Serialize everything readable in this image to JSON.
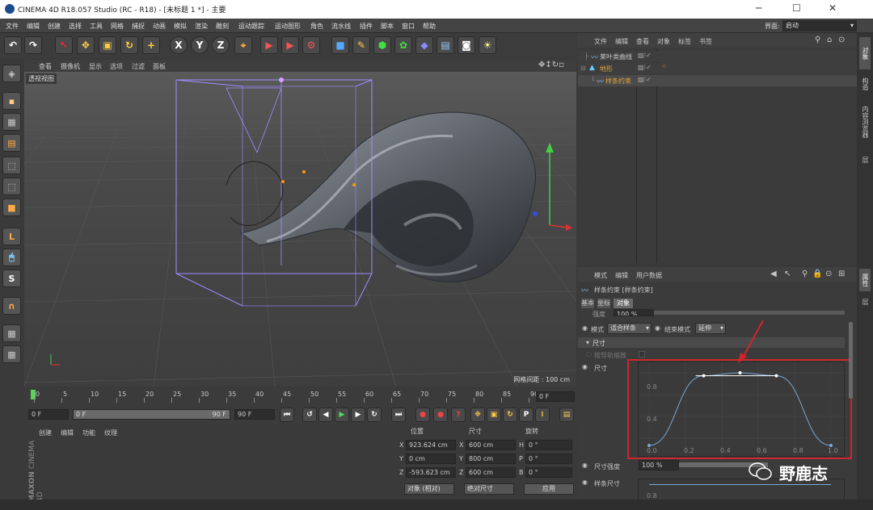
{
  "window": {
    "title": "CINEMA 4D R18.057 Studio (RC - R18) - [未标题 1 *] - 主要",
    "minimize": "─",
    "maximize": "☐",
    "close": "✕"
  },
  "menubar": {
    "items": [
      "文件",
      "编辑",
      "创建",
      "选择",
      "工具",
      "网格",
      "捕捉",
      "动画",
      "模拟",
      "渲染",
      "雕刻",
      "运动跟踪",
      "运动图形",
      "角色",
      "流水线",
      "插件",
      "脚本",
      "窗口",
      "帮助"
    ],
    "layout_label": "界面:",
    "layout_value": "启动"
  },
  "toolbar": {
    "x_label": "X",
    "y_label": "Y",
    "z_label": "Z"
  },
  "viewport": {
    "menu": [
      "查看",
      "摄像机",
      "显示",
      "选项",
      "过滤",
      "面板"
    ],
    "title": "透视视图",
    "grid_info": "网格间距 : 100 cm"
  },
  "timeline": {
    "ticks": [
      "0",
      "5",
      "10",
      "15",
      "20",
      "25",
      "30",
      "35",
      "40",
      "45",
      "50",
      "55",
      "60",
      "65",
      "70",
      "75",
      "80",
      "85",
      "90"
    ],
    "current_frame": "0 F"
  },
  "transport": {
    "start": "0 F",
    "range_start": "0 F",
    "range_end": "90 F",
    "end": "90 F"
  },
  "materials": {
    "menu": [
      "创建",
      "编辑",
      "功能",
      "纹理"
    ],
    "logo_top": "MAXON",
    "logo_bottom": "CINEMA 4D"
  },
  "coords": {
    "headers": [
      "位置",
      "尺寸",
      "旋转"
    ],
    "rows": [
      {
        "axis": "X",
        "pos": "923.624 cm",
        "saxis": "X",
        "size": "600 cm",
        "raxis": "H",
        "rot": "0 °"
      },
      {
        "axis": "Y",
        "pos": "0 cm",
        "saxis": "Y",
        "size": "800 cm",
        "raxis": "P",
        "rot": "0 °"
      },
      {
        "axis": "Z",
        "pos": "-593.623 cm",
        "saxis": "Z",
        "size": "600 cm",
        "raxis": "B",
        "rot": "0 °"
      }
    ],
    "mode": "对象 (相对)",
    "size_mode": "绝对尺寸",
    "apply": "应用"
  },
  "objects": {
    "menu": [
      "文件",
      "编辑",
      "查看",
      "对象",
      "标签",
      "书签"
    ],
    "items": [
      {
        "name": "莱叶类曲线",
        "color": "#d8d8d8"
      },
      {
        "name": "地形",
        "color": "#e0a640"
      },
      {
        "name": "样条约束",
        "color": "#e0a640"
      }
    ]
  },
  "attributes": {
    "menu": [
      "模式",
      "编辑",
      "用户数据"
    ],
    "object_title": "样条约束 [样条约束]",
    "tabs": [
      "基本",
      "坐标",
      "对象"
    ],
    "strength_label": "强度",
    "strength_value": "100 %",
    "mode_label": "模式",
    "mode_value": "适合样条",
    "end_mode_label": "结束模式",
    "end_mode_value": "延伸",
    "size_group": "尺寸",
    "scale_by_track": "按导轨缩放",
    "size_label": "尺寸",
    "size_strength_label": "尺寸强度",
    "size_strength_value": "100 %",
    "spline_size_label": "样条尺寸",
    "curve_y_labels": [
      "0.8",
      "0.4",
      "0.0"
    ],
    "curve_x_labels": [
      "0.0",
      "0.2",
      "0.4",
      "0.6",
      "0.8",
      "1.0"
    ],
    "spline_y_label": "0.8",
    "curve_points": [
      [
        0,
        0
      ],
      [
        0.3,
        0.96
      ],
      [
        0.5,
        1
      ],
      [
        0.7,
        0.96
      ],
      [
        1,
        0
      ]
    ]
  },
  "right_tabs": [
    "对象",
    "构造",
    "内容浏览器",
    "层"
  ],
  "right_tabs_bottom": [
    "属性",
    "层"
  ],
  "watermark": "野鹿志",
  "colors": {
    "highlight_box": "#d0262b",
    "accent_orange": "#e0a640",
    "axis_red": "#e03030",
    "axis_green": "#40d040",
    "axis_blue": "#3050e0",
    "wireframe": "#a08cff"
  }
}
